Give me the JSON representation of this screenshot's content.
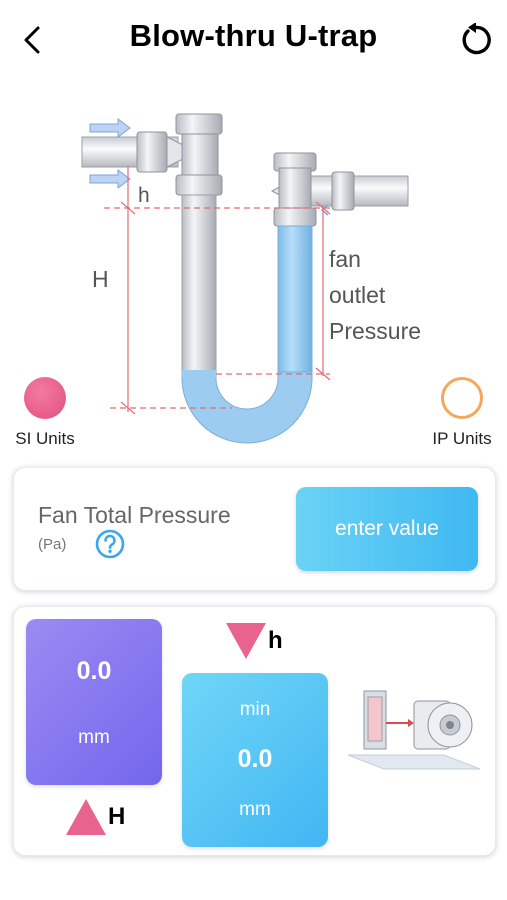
{
  "header": {
    "title": "Blow-thru U-trap",
    "back_icon": "back-chevron-icon",
    "reset_icon": "refresh-icon"
  },
  "diagram": {
    "label_h": "h",
    "label_H": "H",
    "label_fan": "fan",
    "label_outlet": "outlet",
    "label_pressure": "Pressure"
  },
  "units": {
    "si_label": "SI Units",
    "ip_label": "IP Units",
    "selected": "SI Units"
  },
  "input_card": {
    "label": "Fan Total Pressure",
    "unit": "(Pa)",
    "button_label": "enter value",
    "help_icon": "question-circle-icon"
  },
  "results": {
    "H": {
      "value": "0.0",
      "unit": "mm",
      "marker": "H"
    },
    "h": {
      "caption": "min",
      "value": "0.0",
      "unit": "mm",
      "marker": "h"
    },
    "illustration_icon": "fan-unit-illustration-icon"
  },
  "colors": {
    "tile_H": "#7d6ff0",
    "tile_h": "#4fc0f4",
    "radio_on": "#e8578a",
    "radio_off": "#f5a75b",
    "marker": "#e9638f",
    "water": "#8cc8ef"
  }
}
